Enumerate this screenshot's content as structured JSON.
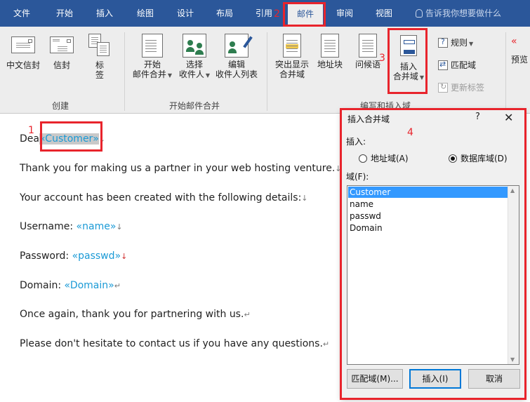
{
  "tabs": [
    {
      "label": "文件"
    },
    {
      "label": "开始"
    },
    {
      "label": "插入"
    },
    {
      "label": "绘图"
    },
    {
      "label": "设计"
    },
    {
      "label": "布局"
    },
    {
      "label": "引用"
    },
    {
      "label": "邮件",
      "active": true
    },
    {
      "label": "审阅"
    },
    {
      "label": "视图"
    }
  ],
  "tell_me": "告诉我你想要做什么",
  "ribbon": {
    "groups": {
      "create": "创建",
      "start_merge": "开始邮件合并",
      "write_insert": "编写和插入域"
    },
    "buttons": {
      "chinese_envelope": "中文信封",
      "envelope": "信封",
      "labels_1": "标",
      "labels_2": "签",
      "start_merge_1": "开始",
      "start_merge_2": "邮件合并",
      "select_recipients_1": "选择",
      "select_recipients_2": "收件人",
      "edit_list_1": "编辑",
      "edit_list_2": "收件人列表",
      "highlight_1": "突出显示",
      "highlight_2": "合并域",
      "address_block": "地址块",
      "greeting": "问候语",
      "insert_field_1": "插入",
      "insert_field_2": "合并域",
      "rules": "规则",
      "match_fields": "匹配域",
      "update_labels": "更新标签",
      "preview": "预览"
    }
  },
  "document": {
    "line1_prefix": "Dea",
    "field_customer": "«Customer»",
    "line2": "Thank you for making us a partner in your web hosting venture.",
    "line3": "Your account has been created with the following details:",
    "username_label": "Username: ",
    "field_name": "«name»",
    "password_label": "Password: ",
    "field_passwd": "«passwd»",
    "domain_label": "Domain: ",
    "field_domain": "«Domain»",
    "line7": "Once again, thank you for partnering with us.",
    "line8": "Please don't hesitate to contact us if you have any questions.",
    "para_mark": "↵",
    "line_mark": "↓"
  },
  "annotations": {
    "n1": "1",
    "n2": "2",
    "n3": "3",
    "n4": "4"
  },
  "dialog": {
    "title": "插入合并域",
    "help": "?",
    "close": "✕",
    "insert_label": "插入:",
    "radio_address": "地址域(A)",
    "radio_database": "数据库域(D)",
    "database_selected": true,
    "fields_label": "域(F):",
    "fields": [
      "Customer",
      "name",
      "passwd",
      "Domain"
    ],
    "selected_field": "Customer",
    "btn_match": "匹配域(M)...",
    "btn_insert": "插入(I)",
    "btn_cancel": "取消"
  },
  "colors": {
    "ribbon_blue": "#2b579a",
    "annotation_red": "#e8242c",
    "field_blue": "#1a9ad6",
    "selection_blue": "#3399ff"
  }
}
